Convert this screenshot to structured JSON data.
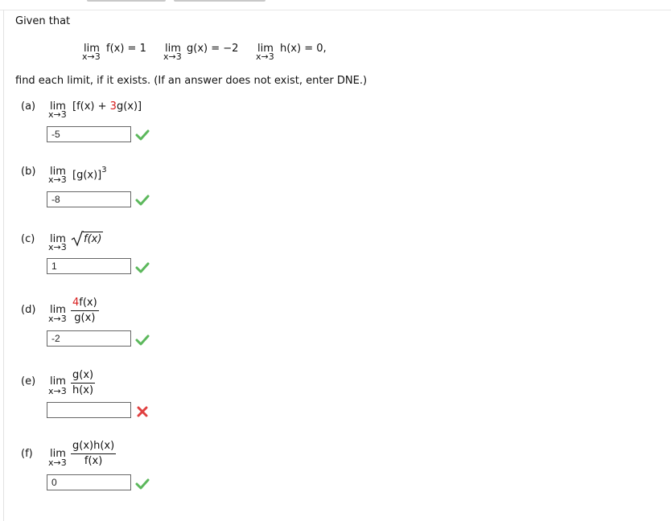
{
  "header": {
    "title": "Given that"
  },
  "given": {
    "f": {
      "lim": "lim",
      "sub": "x→3",
      "expr": "f(x) = 1"
    },
    "g": {
      "lim": "lim",
      "sub": "x→3",
      "expr": "g(x) = −2"
    },
    "h": {
      "lim": "lim",
      "sub": "x→3",
      "expr": "h(x) = 0,"
    }
  },
  "instructions": "find each limit, if it exists. (If an answer does not exist, enter DNE.)",
  "parts": [
    {
      "label": "(a)",
      "lim": "lim",
      "sub": "x→3",
      "expr_pre": "[f(x) + ",
      "expr_red": "3",
      "expr_post": "g(x)]",
      "answer": "-5",
      "status": "correct"
    },
    {
      "label": "(b)",
      "lim": "lim",
      "sub": "x→3",
      "expr": "[g(x)]",
      "exponent": "3",
      "answer": "-8",
      "status": "correct"
    },
    {
      "label": "(c)",
      "lim": "lim",
      "sub": "x→3",
      "radicand": "f(x)",
      "answer": "1",
      "status": "correct"
    },
    {
      "label": "(d)",
      "lim": "lim",
      "sub": "x→3",
      "num_red": "4",
      "num": "f(x)",
      "den": "g(x)",
      "answer": "-2",
      "status": "correct"
    },
    {
      "label": "(e)",
      "lim": "lim",
      "sub": "x→3",
      "num": "g(x)",
      "den": "h(x)",
      "answer": "",
      "status": "incorrect"
    },
    {
      "label": "(f)",
      "lim": "lim",
      "sub": "x→3",
      "num": "g(x)h(x)",
      "den": "f(x)",
      "answer": "0",
      "status": "correct"
    }
  ],
  "colors": {
    "correct": "#5cb85c",
    "incorrect": "#e04040",
    "highlight": "#d71b1b"
  }
}
